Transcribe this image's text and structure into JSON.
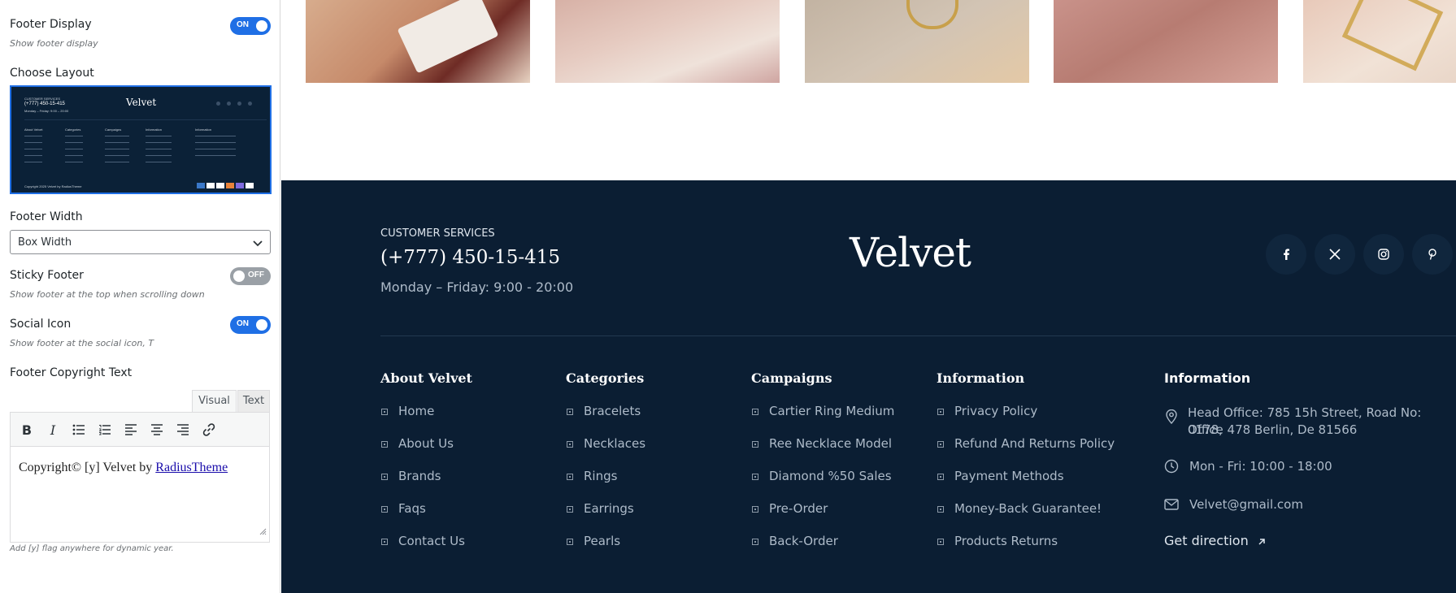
{
  "panel": {
    "footer_display": {
      "label": "Footer Display",
      "desc": "Show footer display",
      "state": "ON"
    },
    "choose_layout": {
      "label": "Choose Layout"
    },
    "footer_width": {
      "label": "Footer Width",
      "value": "Box Width"
    },
    "sticky_footer": {
      "label": "Sticky Footer",
      "desc": "Show footer at the top when scrolling down",
      "state": "OFF"
    },
    "social_icon": {
      "label": "Social Icon",
      "desc": "Show footer at the social icon, T",
      "state": "ON"
    },
    "copyright": {
      "label": "Footer Copyright Text",
      "tab_visual": "Visual",
      "tab_text": "Text",
      "content_prefix": "Copyright© [y] Velvet by ",
      "content_link": "RadiusTheme",
      "hint": "Add [y] flag anywhere for dynamic year."
    }
  },
  "layout_thumb": {
    "cs_label": "CUSTOMER SERVICES",
    "phone": "(+777) 450-15-415",
    "hours": "Monday – Friday: 9:00 – 20:00",
    "logo": "Velvet",
    "cols": [
      "About Velvet",
      "Categories",
      "Campaigns",
      "Information",
      "Information"
    ],
    "copyright": "Copyright 2025 Velvet by RadiusTheme"
  },
  "footer": {
    "cs_label": "CUSTOMER SERVICES",
    "phone": "(+777) 450-15-415",
    "hours": "Monday – Friday: 9:00 - 20:00",
    "logo": "Velvet",
    "social": [
      "facebook-icon",
      "x-icon",
      "instagram-icon",
      "pinterest-icon"
    ],
    "columns": [
      {
        "title": "About Velvet",
        "links": [
          "Home",
          "About Us",
          "Brands",
          "Faqs",
          "Contact Us"
        ]
      },
      {
        "title": "Categories",
        "links": [
          "Bracelets",
          "Necklaces",
          "Rings",
          "Earrings",
          "Pearls"
        ]
      },
      {
        "title": "Campaigns",
        "links": [
          "Cartier Ring Medium",
          "Ree Necklace Model",
          "Diamond %50 Sales",
          "Pre-Order",
          "Back-Order"
        ]
      },
      {
        "title": "Information",
        "links": [
          "Privacy Policy",
          "Refund And Returns Policy",
          "Payment Methods",
          "Money-Back Guarantee!",
          "Products Returns"
        ]
      }
    ],
    "contact": {
      "title": "Information",
      "address_line1": "Head Office: 785 15h Street, Road No: 0178,",
      "address_line2": "Office 478 Berlin, De 81566",
      "hours": "Mon - Fri: 10:00 - 18:00",
      "email": "Velvet@gmail.com",
      "direction": "Get direction"
    }
  },
  "colors": {
    "accent": "#1f6fe5",
    "footer_bg": "#0b1e33",
    "footer_text": "#aebbc9"
  }
}
